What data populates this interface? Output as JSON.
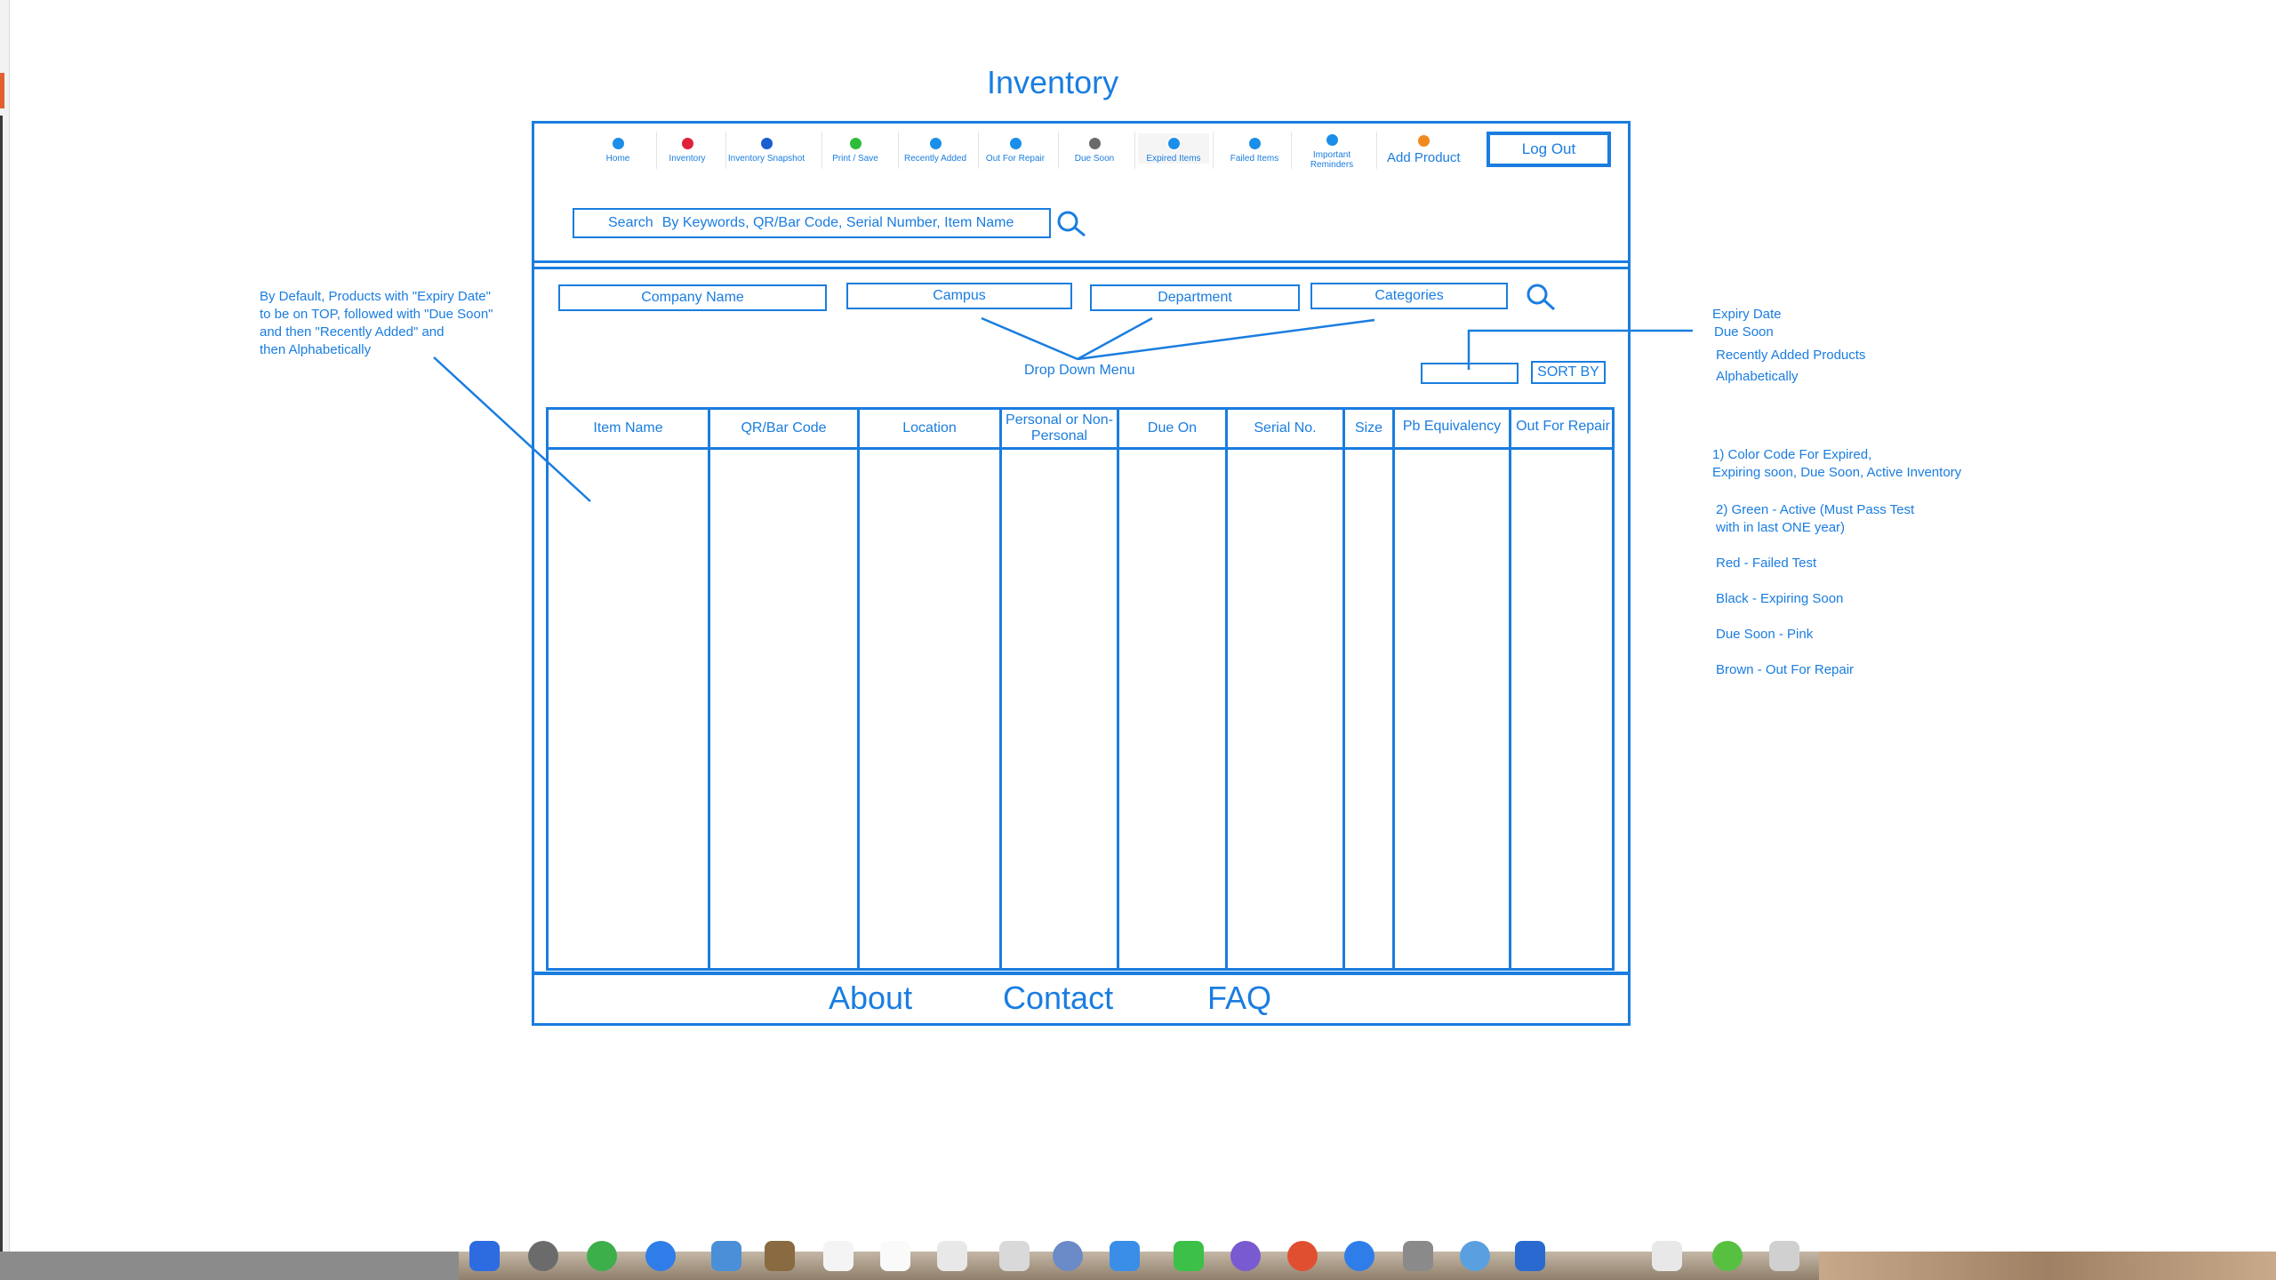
{
  "page": {
    "title": "Inventory"
  },
  "nav": {
    "items": [
      {
        "label": "Home",
        "color": "#1a8ee8"
      },
      {
        "label": "Inventory",
        "color": "#e0203a"
      },
      {
        "label": "Inventory Snapshot",
        "color": "#1a5fd0"
      },
      {
        "label": "Print / Save",
        "color": "#2ebc3a"
      },
      {
        "label": "Recently Added",
        "color": "#1a8ee8"
      },
      {
        "label": "Out For Repair",
        "color": "#1a8ee8"
      },
      {
        "label": "Due Soon",
        "color": "#6a6a6a"
      },
      {
        "label": "Expired Items",
        "color": "#1a8ee8"
      },
      {
        "label": "Failed Items",
        "color": "#1a8ee8"
      },
      {
        "label": "Important Reminders",
        "color": "#1a8ee8"
      }
    ],
    "add_product": "Add Product",
    "logout": "Log Out"
  },
  "search": {
    "label": "Search",
    "hint": "By Keywords, QR/Bar Code, Serial Number, Item Name"
  },
  "filters": [
    "Company Name",
    "Campus",
    "Department",
    "Categories"
  ],
  "dropdown_note": "Drop Down Menu",
  "sort": {
    "label": "SORT BY"
  },
  "table": {
    "headers": [
      "Item Name",
      "QR/Bar Code",
      "Location",
      "Personal or Non-Personal",
      "Due On",
      "Serial No.",
      "Size",
      "Pb Equivalency",
      "Out For Repair"
    ]
  },
  "footer": {
    "links": [
      "About",
      "Contact",
      "FAQ"
    ]
  },
  "notes": {
    "left": [
      "By Default, Products with \"Expiry Date\"",
      "to be on TOP, followed with \"Due Soon\"",
      "and then \"Recently Added\" and",
      "then Alphabetically"
    ],
    "sort_options": [
      "Expiry Date",
      "Due Soon",
      "Recently Added Products",
      "Alphabetically"
    ],
    "color_code_1": [
      "1) Color Code For Expired,",
      "Expiring soon, Due Soon, Active Inventory"
    ],
    "color_code_2": [
      "2) Green - Active (Must Pass Test",
      "with in last ONE year)"
    ],
    "red": "Red - Failed Test",
    "black": "Black - Expiring Soon",
    "pink": "Due Soon - Pink",
    "brown": "Brown - Out For Repair"
  }
}
